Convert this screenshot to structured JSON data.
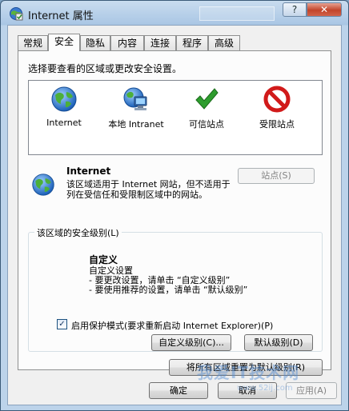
{
  "window": {
    "title": "Internet 属性",
    "help_label": "?",
    "close_label": "✕"
  },
  "tabs": [
    {
      "label": "常规"
    },
    {
      "label": "安全"
    },
    {
      "label": "隐私"
    },
    {
      "label": "内容"
    },
    {
      "label": "连接"
    },
    {
      "label": "程序"
    },
    {
      "label": "高级"
    }
  ],
  "active_tab": "安全",
  "security": {
    "instruction": "选择要查看的区域或更改安全设置。",
    "zones": [
      {
        "label": "Internet",
        "icon": "globe-icon"
      },
      {
        "label": "本地 Intranet",
        "icon": "intranet-icon"
      },
      {
        "label": "可信站点",
        "icon": "checkmark-icon"
      },
      {
        "label": "受限站点",
        "icon": "restricted-icon"
      }
    ],
    "selected_zone": {
      "name": "Internet",
      "description": "该区域适用于 Internet 网站，但不适用于列在受信任和受限制区域中的网站。",
      "sites_label": "站点(S)"
    },
    "level_group_label": "该区域的安全级别(L)",
    "level": {
      "title": "自定义",
      "lines": [
        "自定义设置",
        "- 要更改设置，请单击 “自定义级别”",
        "- 要使用推荐的设置，请单击 “默认级别”"
      ]
    },
    "protected_mode": {
      "checked": true,
      "label": "启用保护模式(要求重新启动 Internet Explorer)(P)"
    },
    "custom_level_label": "自定义级别(C)...",
    "default_level_label": "默认级别(D)",
    "reset_all_label": "将所有区域重置为默认级别(R)"
  },
  "footer": {
    "ok_label": "确定",
    "cancel_label": "取消",
    "apply_label": "应用(A)"
  },
  "watermark": {
    "text": "我爱IT技术网",
    "sub": "www.52ij.com"
  },
  "colors": {
    "titlebar": "#a9c6e4",
    "close_button": "#c2442a",
    "checkmark": "#2e9d2e",
    "restricted": "#d11a1a"
  }
}
